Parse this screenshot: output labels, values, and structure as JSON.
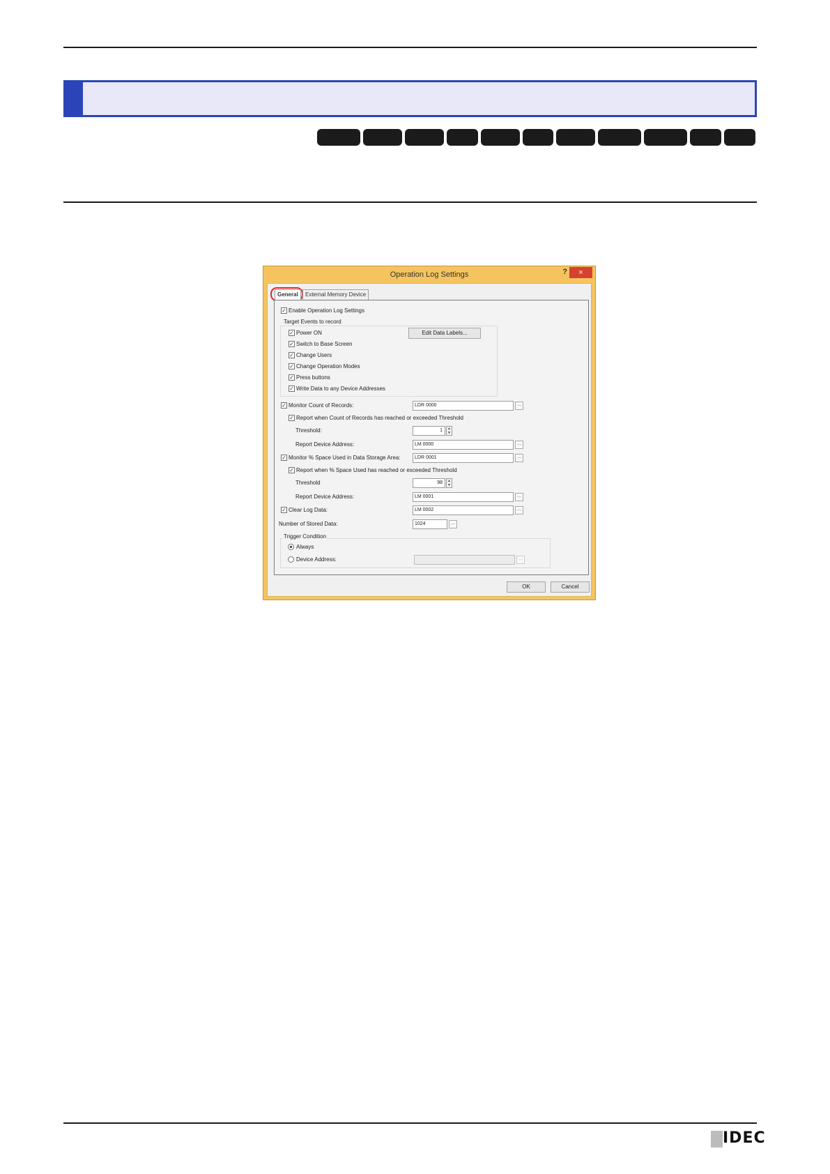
{
  "dialog": {
    "title": "Operation Log Settings",
    "help_label": "?",
    "close_label": "×",
    "tabs": [
      "General",
      "External Memory Device"
    ],
    "enable_label": "Enable Operation Log Settings",
    "target_events_label": "Target Events to record",
    "edit_data_labels_button": "Edit Data Labels...",
    "events": [
      "Power ON",
      "Switch to Base Screen",
      "Change Users",
      "Change Operation Modes",
      "Press buttons",
      "Write Data to any Device Addresses"
    ],
    "monitor_count_label": "Monitor Count of Records:",
    "monitor_count_value": "LDR 0000",
    "report_count_label": "Report when Count of Records has reached or exceeded Threshold",
    "threshold_label_1": "Threshold:",
    "threshold_value_1": "1",
    "report_address_label_1": "Report Device Address:",
    "report_address_value_1": "LM 0000",
    "monitor_space_label": "Monitor % Space Used in Data Storage Area:",
    "monitor_space_value": "LDR 0001",
    "report_space_label": "Report when % Space Used has reached or exceeded Threshold",
    "threshold_label_2": "Threshold",
    "threshold_value_2": "98",
    "report_address_label_2": "Report Device Address:",
    "report_address_value_2": "LM 0001",
    "clear_log_label": "Clear Log Data:",
    "clear_log_value": "LM 0002",
    "stored_data_label": "Number of Stored Data:",
    "stored_data_value": "1024",
    "trigger_condition_label": "Trigger Condition",
    "trigger_always_label": "Always",
    "trigger_device_label": "Device Address:",
    "browse_label": "...",
    "ok_button": "OK",
    "cancel_button": "Cancel"
  },
  "footer": {
    "logo_text": "IDEC"
  }
}
